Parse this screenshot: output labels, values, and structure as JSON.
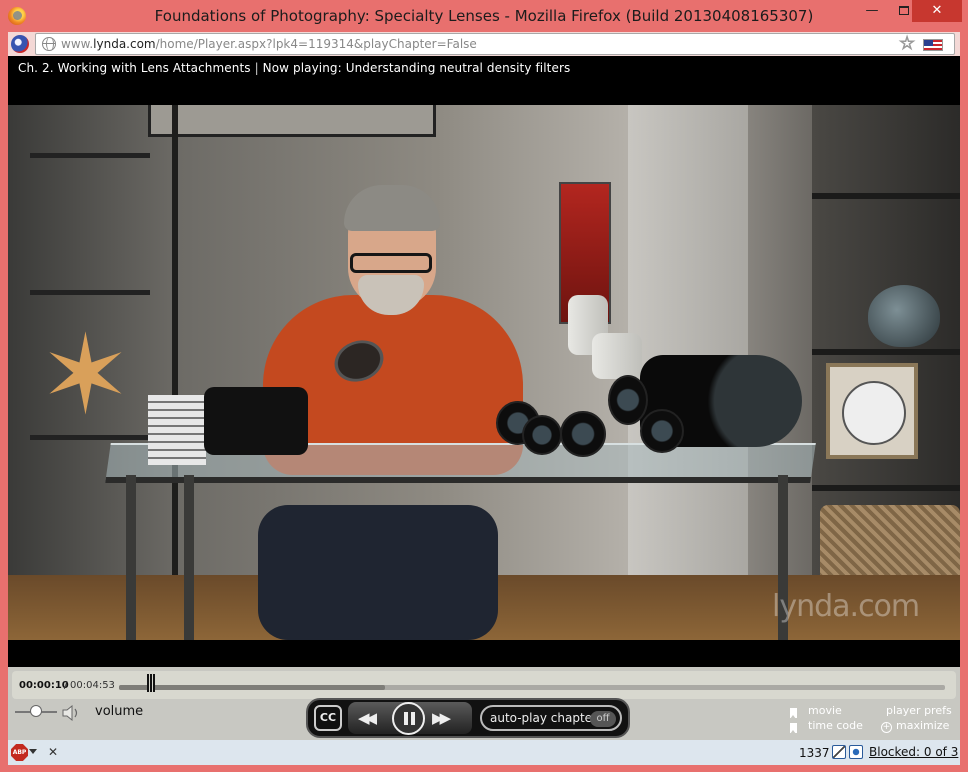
{
  "window": {
    "title": "Foundations of Photography: Specialty Lenses - Mozilla Firefox (Build 20130408165307)",
    "minimize_glyph": "—",
    "close_glyph": "✕"
  },
  "navbar": {
    "url_prefix": "www.",
    "url_domain": "lynda.com",
    "url_path": "/home/Player.aspx?lpk4=119314&playChapter=False",
    "bookmark_glyph": "☆"
  },
  "player": {
    "chapter": "Ch. 2. Working with Lens Attachments",
    "separator": "|",
    "now_playing": "Now playing: Understanding neutral density filters",
    "watermark": "lynda.com",
    "time_current": "00:00:10",
    "time_slash": "/",
    "time_total": "00:04:53",
    "progress_fraction": 0.034,
    "loaded_fraction": 0.322,
    "volume_level": 0.5,
    "volume_label": "volume",
    "cc_label": "CC",
    "prev_glyph": "◀◀",
    "next_glyph": "▶▶",
    "autoplay_label": "auto-play chapter",
    "autoplay_state": "off",
    "options": {
      "movie": "movie",
      "time_code": "time code",
      "player_prefs": "player prefs",
      "maximize": "maximize",
      "maximize_glyph": "+"
    }
  },
  "statusbar": {
    "abp_label": "ABP",
    "close_glyph": "✕",
    "count": "1337",
    "blocked": "Blocked: 0 of 3"
  },
  "colors": {
    "window_frame": "#e8706e",
    "close_button": "#c7372f",
    "player_bar": "#c8c8c2",
    "status_bar": "#dde6ee"
  }
}
